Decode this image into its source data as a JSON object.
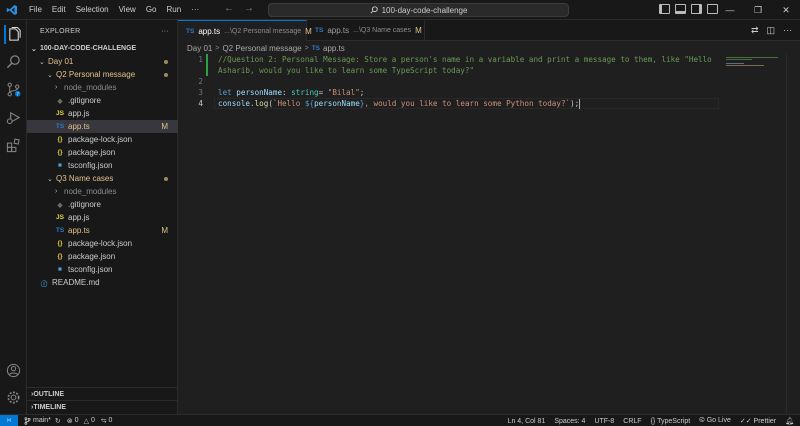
{
  "menu": [
    "File",
    "Edit",
    "Selection",
    "View",
    "Go",
    "Run",
    "···"
  ],
  "search": {
    "text": "100-day-code-challenge"
  },
  "sidebar": {
    "title": "EXPLORER",
    "more": "···",
    "root": "100-DAY-CODE-CHALLENGE",
    "tree": [
      {
        "label": "Day 01",
        "kind": "folder",
        "indent": 1,
        "open": true,
        "status": "dot",
        "modified": true
      },
      {
        "label": "Q2 Personal message",
        "kind": "folder",
        "indent": 2,
        "open": true,
        "status": "dot",
        "modified": true
      },
      {
        "label": "node_modules",
        "kind": "folder",
        "indent": 3,
        "open": false,
        "dim": true
      },
      {
        "label": ".gitignore",
        "kind": "git",
        "indent": 3
      },
      {
        "label": "app.js",
        "kind": "js",
        "indent": 3
      },
      {
        "label": "app.ts",
        "kind": "ts",
        "indent": 3,
        "status": "M",
        "modified": true,
        "selected": true
      },
      {
        "label": "package-lock.json",
        "kind": "json",
        "indent": 3
      },
      {
        "label": "package.json",
        "kind": "json",
        "indent": 3
      },
      {
        "label": "tsconfig.json",
        "kind": "tsconfig",
        "indent": 3
      },
      {
        "label": "Q3 Name cases",
        "kind": "folder",
        "indent": 2,
        "open": true,
        "status": "dot",
        "modified": true
      },
      {
        "label": "node_modules",
        "kind": "folder",
        "indent": 3,
        "open": false,
        "dim": true
      },
      {
        "label": ".gitignore",
        "kind": "git",
        "indent": 3
      },
      {
        "label": "app.js",
        "kind": "js",
        "indent": 3
      },
      {
        "label": "app.ts",
        "kind": "ts",
        "indent": 3,
        "status": "M",
        "modified": true
      },
      {
        "label": "package-lock.json",
        "kind": "json",
        "indent": 3
      },
      {
        "label": "package.json",
        "kind": "json",
        "indent": 3
      },
      {
        "label": "tsconfig.json",
        "kind": "tsconfig",
        "indent": 3
      },
      {
        "label": "README.md",
        "kind": "info",
        "indent": 1
      }
    ],
    "outline": "OUTLINE",
    "timeline": "TIMELINE"
  },
  "tabs": [
    {
      "icon": "TS",
      "name": "app.ts",
      "desc": "...\\Q2 Personal message",
      "status": "M",
      "active": true
    },
    {
      "icon": "TS",
      "name": "app.ts",
      "desc": "...\\Q3 Name cases",
      "status": "M",
      "active": false
    }
  ],
  "breadcrumb": {
    "folder": "Day 01",
    "subfolder": "Q2 Personal message",
    "file_icon": "TS",
    "file": "app.ts",
    "sep": ">"
  },
  "editor": {
    "line_numbers": [
      "1",
      "",
      "2",
      "3",
      "4"
    ],
    "comment_line1": "//Question 2: Personal Message: Store a person's name in a variable and print a message to them, like \"Hello",
    "comment_line2": "Asharib, would you like to learn some TypeScript today?\"",
    "let_kw": "let",
    "var_name": "personName",
    "colon": ": ",
    "type_name": "string",
    "assign": "= ",
    "string_val": "\"Bilal\"",
    "semi": ";",
    "console": "console",
    "dot": ".",
    "log_fn": "log",
    "open_paren": "(",
    "tpl_start": "`Hello ",
    "interp_open": "${",
    "interp_var": "personName",
    "interp_close": "}",
    "tpl_end": ", would you like to learn some Python today?`",
    "close": ");"
  },
  "status": {
    "branch": "main*",
    "errors": "0",
    "warnings": "0",
    "ports": "0",
    "position": "Ln 4, Col 81",
    "spaces": "Spaces: 4",
    "encoding": "UTF-8",
    "eol": "CRLF",
    "language": "TypeScript",
    "golive": "Go Live",
    "prettier": "Prettier"
  },
  "colors": {
    "accent": "#0078d4",
    "modified": "#e2c08d",
    "ts": "#3178c6",
    "comment": "#6a9955",
    "keyword": "#569cd6",
    "string": "#ce9178"
  }
}
